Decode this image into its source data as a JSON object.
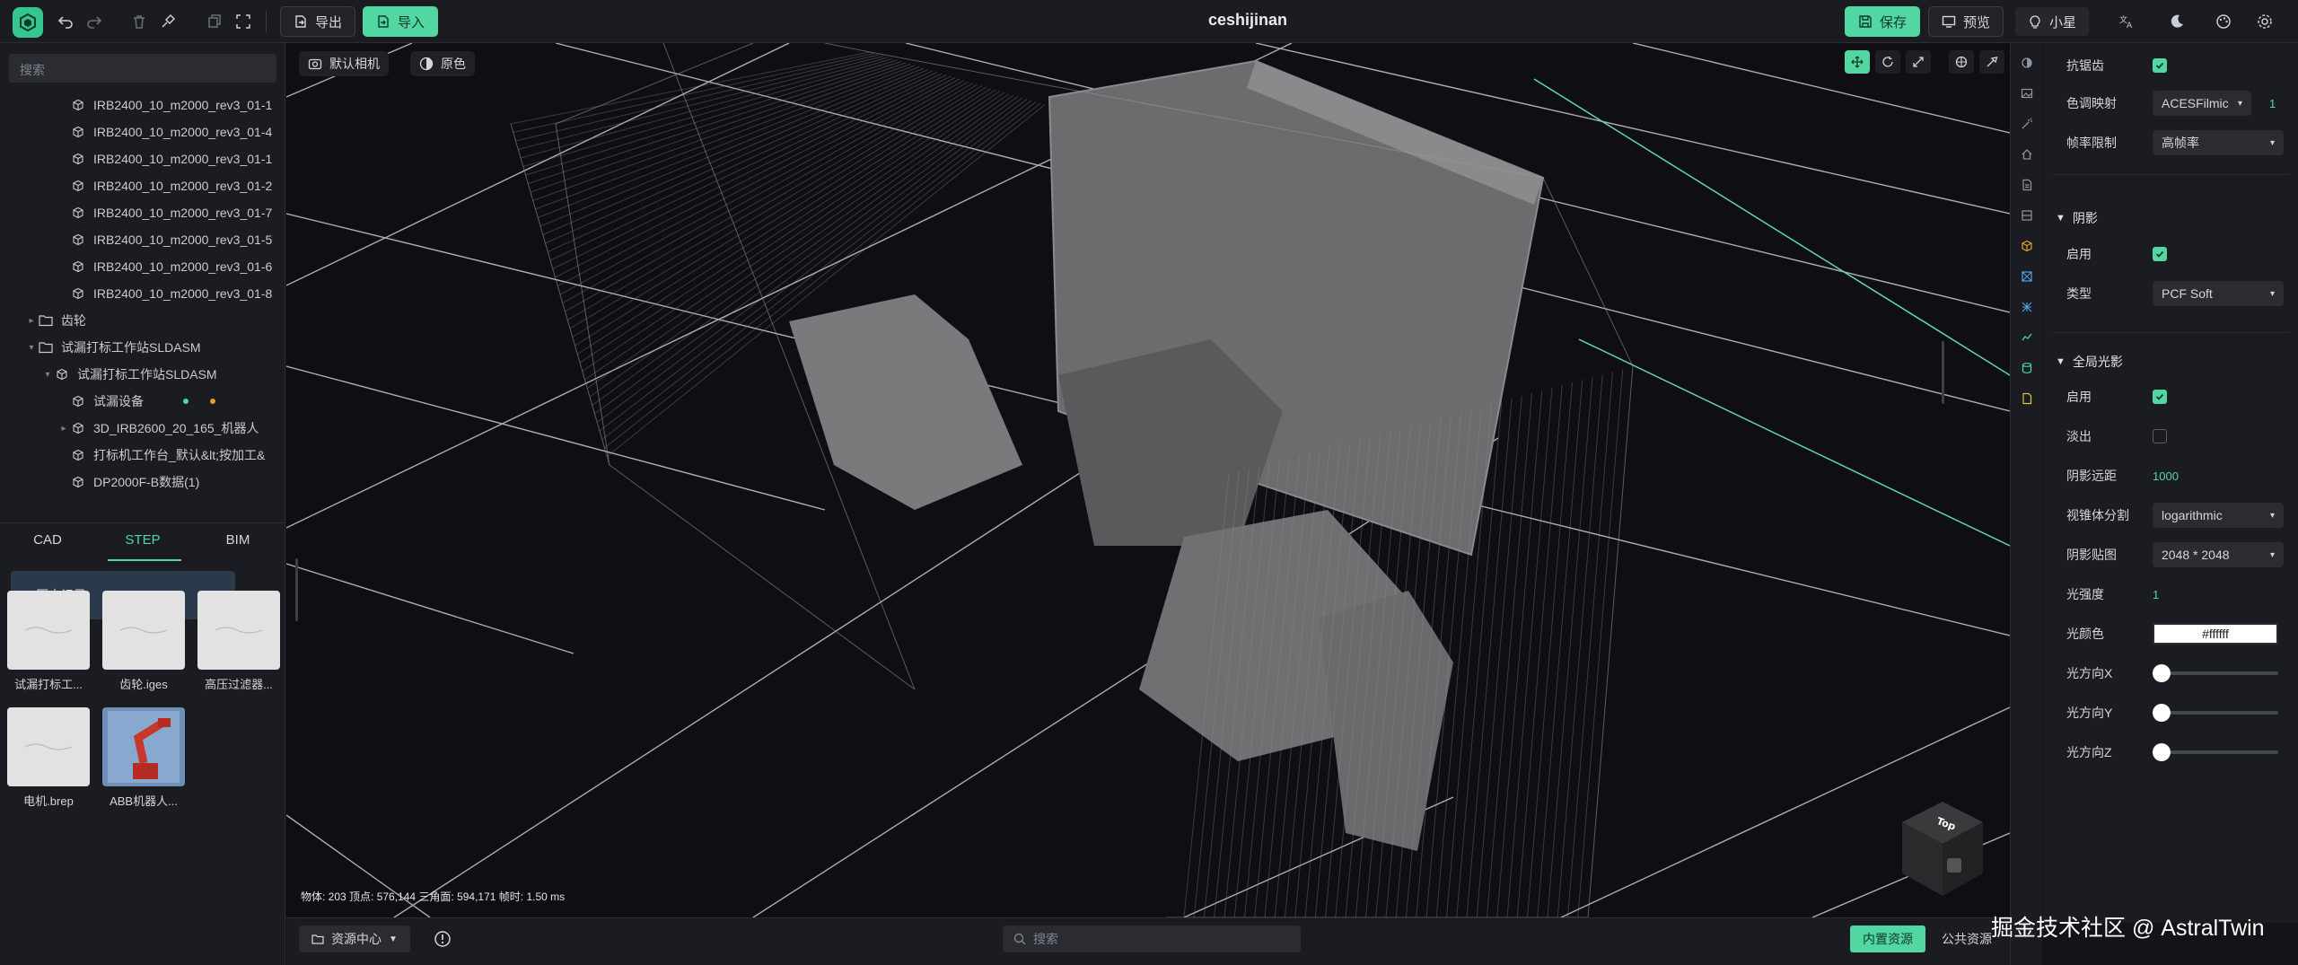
{
  "app": {
    "doc_title": "ceshijinan"
  },
  "toolbar": {
    "export_label": "导出",
    "import_label": "导入",
    "save_label": "保存",
    "preview_label": "预览",
    "assistant_label": "小星"
  },
  "left": {
    "search_placeholder": "搜索",
    "tree": [
      {
        "label": "IRB2400_10_m2000_rev3_01-1",
        "indent": 3,
        "kind": "part"
      },
      {
        "label": "IRB2400_10_m2000_rev3_01-4",
        "indent": 3,
        "kind": "part"
      },
      {
        "label": "IRB2400_10_m2000_rev3_01-1",
        "indent": 3,
        "kind": "part"
      },
      {
        "label": "IRB2400_10_m2000_rev3_01-2",
        "indent": 3,
        "kind": "part"
      },
      {
        "label": "IRB2400_10_m2000_rev3_01-7",
        "indent": 3,
        "kind": "part"
      },
      {
        "label": "IRB2400_10_m2000_rev3_01-5",
        "indent": 3,
        "kind": "part"
      },
      {
        "label": "IRB2400_10_m2000_rev3_01-6",
        "indent": 3,
        "kind": "part"
      },
      {
        "label": "IRB2400_10_m2000_rev3_01-8",
        "indent": 3,
        "kind": "part"
      },
      {
        "label": "齿轮",
        "indent": 1,
        "kind": "folder",
        "arrow": "▸"
      },
      {
        "label": "试漏打标工作站SLDASM",
        "indent": 1,
        "kind": "folder",
        "arrow": "▾"
      },
      {
        "label": "试漏打标工作站SLDASM",
        "indent": 2,
        "kind": "part",
        "arrow": "▾"
      },
      {
        "label": "试漏设备",
        "indent": 3,
        "kind": "part",
        "dots": true
      },
      {
        "label": "3D_IRB2600_20_165_机器人",
        "indent": 3,
        "kind": "part",
        "arrow": "▸"
      },
      {
        "label": "打标机工作台_默认&lt;按加工&",
        "indent": 3,
        "kind": "part"
      },
      {
        "label": "DP2000F-B数据(1)",
        "indent": 3,
        "kind": "part"
      }
    ],
    "tabs": [
      "CAD",
      "STEP",
      "BIM"
    ],
    "active_tab": 1,
    "history_label": "历史记录",
    "assets": [
      {
        "label": "试漏打标工...",
        "thumb": "light"
      },
      {
        "label": "齿轮.iges",
        "thumb": "light"
      },
      {
        "label": "高压过滤器...",
        "thumb": "light"
      },
      {
        "label": "电机.brep",
        "thumb": "light"
      },
      {
        "label": "ABB机器人...",
        "thumb": "robot"
      }
    ]
  },
  "viewport": {
    "camera_label": "默认相机",
    "color_mode_label": "原色",
    "stats": "物体: 203  顶点: 576,144  三角面: 594,171  帧时: 1.50 ms",
    "gizmo_active": "move-icon"
  },
  "bottom": {
    "resource_center_label": "资源中心",
    "search_placeholder": "搜索",
    "builtin_label": "内置资源",
    "public_label": "公共资源"
  },
  "settings": {
    "antialias_label": "抗锯齿",
    "tone_mapping_label": "色调映射",
    "tone_mapping_value": "ACESFilmic",
    "tone_mapping_exposure": "1",
    "frame_limit_label": "帧率限制",
    "frame_limit_value": "高帧率",
    "shadow_section": "阴影",
    "shadow_enable_label": "启用",
    "shadow_type_label": "类型",
    "shadow_type_value": "PCF Soft",
    "gi_section": "全局光影",
    "gi_enable_label": "启用",
    "fade_label": "淡出",
    "shadow_distance_label": "阴影远距",
    "shadow_distance_value": "1000",
    "cascade_label": "视锥体分割",
    "cascade_value": "logarithmic",
    "shadow_map_label": "阴影贴图",
    "shadow_map_value": "2048 * 2048",
    "light_intensity_label": "光强度",
    "light_intensity_value": "1",
    "light_color_label": "光颜色",
    "light_color_value": "#ffffff",
    "dir_x_label": "光方向X",
    "dir_y_label": "光方向Y",
    "dir_z_label": "光方向Z",
    "dir_x": 0,
    "dir_y": 0,
    "dir_z": 0
  },
  "watermark": "掘金技术社区 @ AstralTwin",
  "colors": {
    "accent": "#52d6a2",
    "bg": "#141418",
    "panel": "#1b1c21"
  }
}
